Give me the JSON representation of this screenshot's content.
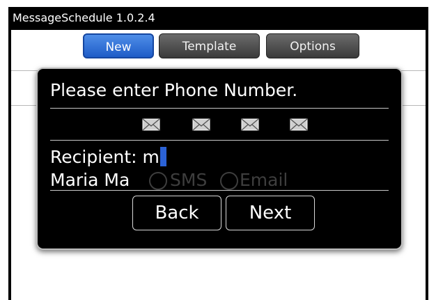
{
  "app": {
    "title": "MessageSchedule 1.0.2.4"
  },
  "tabs": [
    {
      "label": "New",
      "active": true
    },
    {
      "label": "Template",
      "active": false
    },
    {
      "label": "Options",
      "active": false
    }
  ],
  "dialog": {
    "prompt": "Please enter Phone Number.",
    "recipient_label": "Recipient:",
    "recipient_value": "m",
    "suggestion": "Maria Ma",
    "channel_options": [
      "SMS",
      "Email"
    ],
    "icons": [
      "envelope-icon",
      "envelope-icon",
      "envelope-icon",
      "envelope-icon"
    ],
    "back_label": "Back",
    "next_label": "Next"
  },
  "colors": {
    "accent": "#1e5cc7",
    "caret": "#2b62d6"
  }
}
